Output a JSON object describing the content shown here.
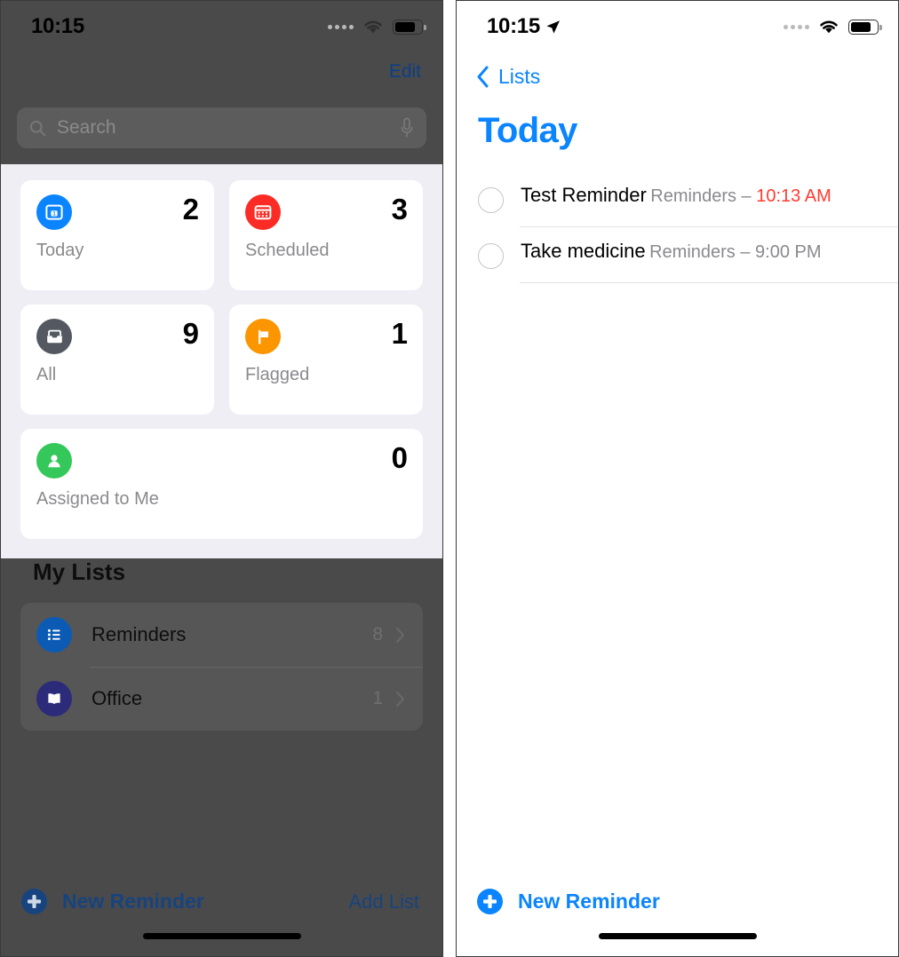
{
  "left_screen": {
    "status_bar": {
      "time": "10:15",
      "signal_icon": "signal-dots-icon",
      "wifi_icon": "wifi-icon",
      "battery_icon": "battery-icon"
    },
    "edit_button": "Edit",
    "search": {
      "placeholder": "Search",
      "search_icon": "search-icon",
      "mic_icon": "microphone-icon"
    },
    "smart_lists": [
      {
        "label": "Today",
        "count": "2",
        "icon": "calendar-day-icon",
        "color": "#0a84ff"
      },
      {
        "label": "Scheduled",
        "count": "3",
        "icon": "calendar-icon",
        "color": "#fb2c25"
      },
      {
        "label": "All",
        "count": "9",
        "icon": "inbox-tray-icon",
        "color": "#545961"
      },
      {
        "label": "Flagged",
        "count": "1",
        "icon": "flag-icon",
        "color": "#fb9500"
      },
      {
        "label": "Assigned to Me",
        "count": "0",
        "icon": "person-circle-icon",
        "color": "#34c759"
      }
    ],
    "my_lists": {
      "header": "My Lists",
      "items": [
        {
          "name": "Reminders",
          "count": "8",
          "icon": "bulleted-list-icon",
          "color": "#0b5bb5",
          "chevron": "chevron-right-icon"
        },
        {
          "name": "Office",
          "count": "1",
          "icon": "book-icon",
          "color": "#2b2b7a",
          "chevron": "chevron-right-icon"
        }
      ]
    },
    "bottom_bar": {
      "new_reminder": "New Reminder",
      "plus_icon": "plus-circle-icon",
      "add_list": "Add List"
    }
  },
  "right_screen": {
    "status_bar": {
      "time": "10:15",
      "location_icon": "location-arrow-icon",
      "signal_icon": "signal-dots-icon",
      "wifi_icon": "wifi-icon",
      "battery_icon": "battery-icon"
    },
    "back": {
      "label": "Lists",
      "icon": "chevron-left-icon"
    },
    "title": "Today",
    "reminders": [
      {
        "title": "Test Reminder",
        "list_name": "Reminders",
        "separator": " – ",
        "time": "10:13 AM",
        "time_overdue": true,
        "checkbox_icon": "empty-circle-icon"
      },
      {
        "title": "Take medicine",
        "list_name": "Reminders",
        "separator": " – ",
        "time": "9:00 PM",
        "time_overdue": false,
        "checkbox_icon": "empty-circle-icon"
      }
    ],
    "bottom_bar": {
      "new_reminder": "New Reminder",
      "plus_icon": "plus-circle-icon"
    }
  },
  "colors": {
    "accent_blue": "#0a84ff",
    "overdue_red": "#ff3b30",
    "dim_overlay": "#4a4a4a",
    "highlight_bg": "#eeeef4",
    "card_white": "#ffffff"
  }
}
